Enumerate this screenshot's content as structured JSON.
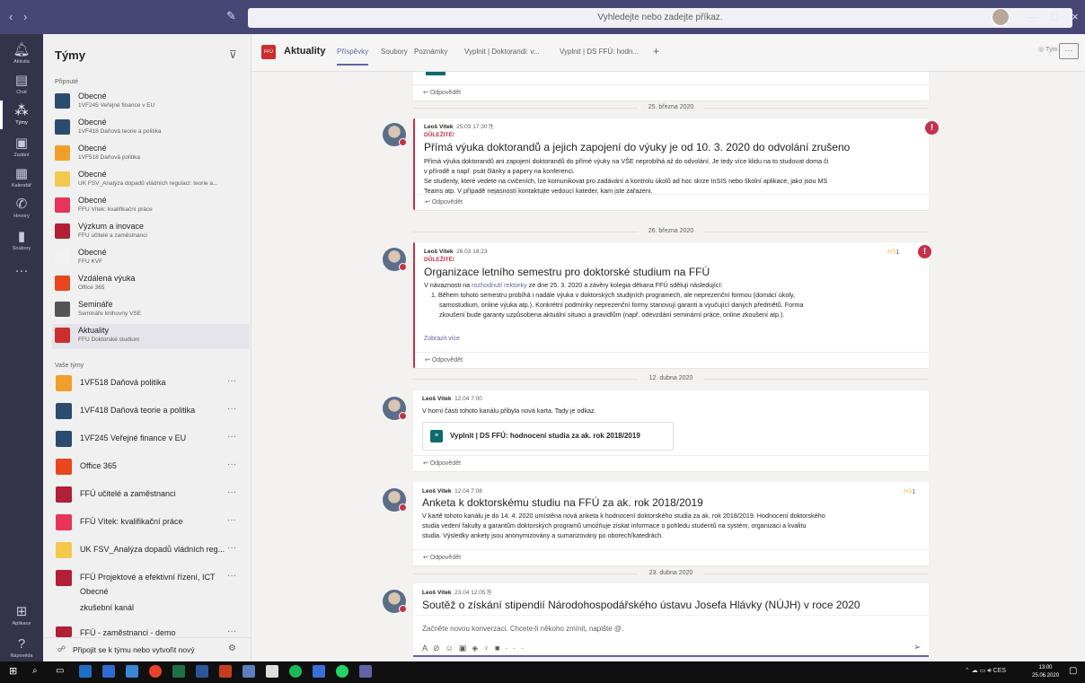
{
  "topbar": {
    "search_placeholder": "Vyhledejte nebo zadejte příkaz."
  },
  "rail": [
    {
      "label": "Aktivita",
      "icon": "bell-icon"
    },
    {
      "label": "Chat",
      "icon": "chat-icon"
    },
    {
      "label": "Týmy",
      "icon": "teams-icon",
      "active": true
    },
    {
      "label": "Zadání",
      "icon": "assignments-icon"
    },
    {
      "label": "Kalendář",
      "icon": "calendar-icon"
    },
    {
      "label": "Hovory",
      "icon": "phone-icon"
    },
    {
      "label": "Soubory",
      "icon": "file-icon"
    },
    {
      "label": "Aplikace",
      "icon": "apps-icon"
    },
    {
      "label": "Nápověda",
      "icon": "help-icon"
    }
  ],
  "leftpanel": {
    "title": "Týmy",
    "pinned_label": "Připnuté",
    "your_teams_label": "Vaše týmy",
    "pinned": [
      {
        "name": "Obecné",
        "team": "1VF245 Veřejné finance v EU",
        "color": "#2b4c6e"
      },
      {
        "name": "Obecné",
        "team": "1VF418 Daňová teorie a politika",
        "color": "#2b4c6e"
      },
      {
        "name": "Obecné",
        "team": "1VF518 Daňová politika",
        "color": "#f0a02a"
      },
      {
        "name": "Obecné",
        "team": "UK FSV_Analýza dopadů vládních regulací: teorie a...",
        "color": "#f2c94c"
      },
      {
        "name": "Obecné",
        "team": "FFÚ Vítek: kvalifikační práce",
        "color": "#e8345a"
      },
      {
        "name": "Výzkum a inovace",
        "team": "FFÚ učitelé a zaměstnanci",
        "color": "#b02036"
      },
      {
        "name": "Obecné",
        "team": "FFÚ KVF",
        "color": "#f3f2f1"
      },
      {
        "name": "Vzdálená výuka",
        "team": "Office 365",
        "color": "#e8461e"
      },
      {
        "name": "Semináře",
        "team": "Semináře knihovny VŠE",
        "color": "#555"
      },
      {
        "name": "Aktuality",
        "team": "FFÚ Doktorské studium",
        "color": "#cc2e2e",
        "selected": true
      }
    ],
    "teams": [
      {
        "name": "1VF518 Daňová politika",
        "color": "#f0a02a"
      },
      {
        "name": "1VF418 Daňová teorie a politika",
        "color": "#2b4c6e"
      },
      {
        "name": "1VF245 Veřejné finance v EU",
        "color": "#2b4c6e"
      },
      {
        "name": "Office 365",
        "color": "#e8461e"
      },
      {
        "name": "FFÚ učitelé a zaměstnanci",
        "color": "#b02036"
      },
      {
        "name": "FFÚ Vítek: kvalifikační práce",
        "color": "#e8345a"
      },
      {
        "name": "UK FSV_Analýza dopadů vládních reg...",
        "color": "#f2c94c"
      },
      {
        "name": "FFÚ Projektové a efektivní řízení, ICT",
        "color": "#b02036"
      }
    ],
    "channels": [
      "Obecné",
      "zkušební kanál"
    ],
    "demo_team": "FFÚ - zaměstnanci - demo",
    "join_label": "Připojit se k týmu nebo vytvořit nový"
  },
  "header": {
    "channel": "Aktuality",
    "logo_text": "FFÚ",
    "tabs": [
      "Příspěvky",
      "Soubory",
      "Poznámky",
      "Vyplnit | Doktorandi: v...",
      "Vyplnit | DS FFÚ: hodn..."
    ],
    "team_button": "Tým",
    "more": "···"
  },
  "feed": {
    "reply_label": "Odpovědět",
    "dates": [
      "25. března 2020",
      "26. března 2020",
      "12. dubna 2020",
      "23. dubna 2020"
    ],
    "important_label": "DŮLEŽITÉ!",
    "show_more": "Zobrazit více",
    "posts": [
      {
        "author": "Leoš Vítek",
        "time": "25.03 17:30",
        "title": "Přímá výuka doktorandů a jejich zapojení do výuky je od 10. 3. 2020 do odvolání zrušeno",
        "lines": [
          "Přímá výuka doktorandů ani zapojení doktorandů do přímé výuky na VŠE neprobíhá až do odvolání. Je tedy více klidu na to studovat doma či",
          "v přírodě a např. psát články a papery na konferenci.",
          "Se studenty, které vedete na cvičeních, lze komunikovat pro zadávání a kontrolu úkolů ad hoc skrze InSIS nebo školní aplikace, jako jsou MS",
          "Teams atp. V případě nejasností kontaktujte vedoucí kateder, kam jste zařazeni."
        ]
      },
      {
        "author": "Leoš Vítek",
        "time": "26.03 18:23",
        "likes": "1",
        "title": "Organizace letního semestru pro doktorské studium na FFÚ",
        "intro_a": "V návaznosti na ",
        "intro_link": "rozhodnutí rektorky",
        "intro_b": " ze dne 25. 3. 2020 a závěry kolegia děkana FFÚ sděluji následující:",
        "lines": [
          "1. Během tohoto semestru probíhá i nadále výuka v doktorských studijních programech, ale neprezenční formou (domácí úkoly,",
          "samostudium, online výuka atp.). Konkrétní podmínky neprezenční formy stanovují garanti a vyučující daných předmětů. Forma",
          "zkoušení bude garanty uzpůsobena aktuální situaci a pravidlům (např. odevzdání seminární práce, online zkoušení atp.)."
        ]
      },
      {
        "author": "Leoš Vítek",
        "time": "12.04 7:00",
        "text": "V horní části tohoto kanálu přibyla nová karta. Tady je odkaz.",
        "card": "Vyplnit | DS FFÚ: hodnocení studia za ak. rok 2018/2019"
      },
      {
        "author": "Leoš Vítek",
        "time": "12.04 7:08",
        "likes": "1",
        "title": "Anketa k doktorskému studiu na FFÚ za ak. rok 2018/2019",
        "lines": [
          "V kartě tohoto kanálu je do 14. 4. 2020 umístěna nová anketa k hodnocení doktorského studia za ak. rok 2018/2019. Hodnocení doktorského",
          "studia vedení fakulty a garantům doktorských programů umožňuje získat informace o pohledu studentů na systém, organizaci a kvalitu",
          "studia. Výsledky ankety jsou anonymizovány a sumarizovány po oborech/katedrách."
        ]
      },
      {
        "author": "Leoš Vítek",
        "time": "23.04 12:05",
        "title": "Soutěž o získání stipendií Národohospodářského ústavu Josefa Hlávky (NÚJH) v roce 2020"
      }
    ]
  },
  "compose": {
    "placeholder": "Začněte novou konverzaci. Chcete-li někoho zmínit, napište @."
  },
  "taskbar": {
    "lang": "CES",
    "time": "13:00",
    "date": "25.06.2020"
  }
}
